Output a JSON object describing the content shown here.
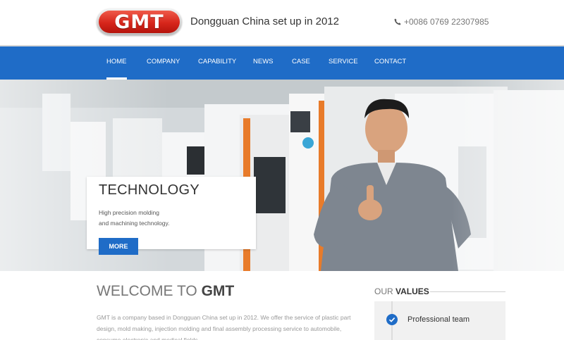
{
  "header": {
    "logo_text": "GMT",
    "tagline": "Dongguan China set up in 2012",
    "phone": "+0086 0769 22307985",
    "phone_icon": "phone-icon"
  },
  "nav": {
    "items": [
      {
        "label": "HOME",
        "active": true
      },
      {
        "label": "COMPANY"
      },
      {
        "label": "CAPABILITY"
      },
      {
        "label": "NEWS"
      },
      {
        "label": "CASE"
      },
      {
        "label": "SERVICE"
      },
      {
        "label": "CONTACT"
      }
    ]
  },
  "hero": {
    "title": "TECHNOLOGY",
    "desc_line1": "High precision molding",
    "desc_line2": "and machining technology.",
    "button": "MORE"
  },
  "welcome": {
    "prefix": "WELCOME TO ",
    "brand": "GMT",
    "body": "GMT is a company based in Dongguan China set up in 2012. We offer the service of plastic part design, mold making, injection molding and final assembly processing service to automobile, consume electronic and medical fields."
  },
  "values": {
    "heading_prefix": "OUR ",
    "heading_bold": "VALUES",
    "items": [
      {
        "label": "Professional team",
        "icon": "check-icon"
      }
    ]
  },
  "colors": {
    "brand_blue": "#1f6cc7",
    "logo_red": "#d7261b"
  }
}
